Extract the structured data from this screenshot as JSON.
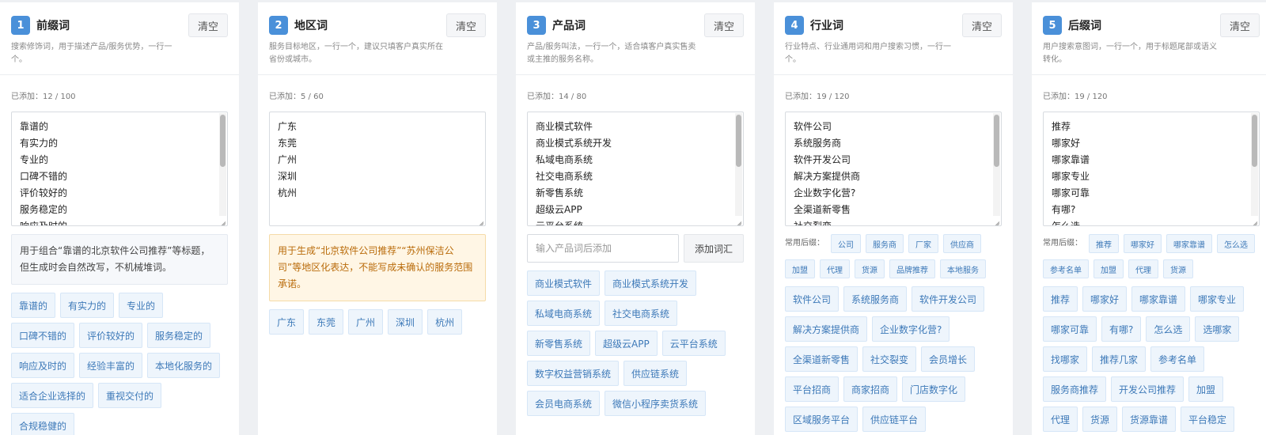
{
  "columns": [
    {
      "num": "1",
      "title": "前缀词",
      "clear": "清空",
      "desc": "搜索修饰词，用于描述产品/服务优势，一行一个。",
      "count": "已添加：12 / 100",
      "lines": [
        "靠谱的",
        "有实力的",
        "专业的",
        "口碑不错的",
        "评价较好的",
        "服务稳定的",
        "响应及时的"
      ],
      "note": "用于组合“靠谱的北京软件公司推荐”等标题，但生成时会自然改写，不机械堆词。",
      "chips": [
        "靠谱的",
        "有实力的",
        "专业的",
        "口碑不错的",
        "评价较好的",
        "服务稳定的",
        "响应及时的",
        "经验丰富的",
        "本地化服务的",
        "适合企业选择的",
        "重视交付的",
        "合规稳健的"
      ]
    },
    {
      "num": "2",
      "title": "地区词",
      "clear": "清空",
      "desc": "服务目标地区，一行一个，建议只填客户真实所在省份或城市。",
      "count": "已添加：5 / 60",
      "lines": [
        "广东",
        "东莞",
        "广州",
        "深圳",
        "杭州"
      ],
      "note": "用于生成“北京软件公司推荐”“苏州保洁公司”等地区化表达，不能写成未确认的服务范围承诺。",
      "chips": [
        "广东",
        "东莞",
        "广州",
        "深圳",
        "杭州"
      ]
    },
    {
      "num": "3",
      "title": "产品词",
      "clear": "清空",
      "desc": "产品/服务叫法，一行一个，适合填客户真实售卖或主推的服务名称。",
      "count": "已添加：14 / 80",
      "lines": [
        "商业模式软件",
        "商业模式系统开发",
        "私域电商系统",
        "社交电商系统",
        "新零售系统",
        "超级云APP",
        "云平台系统"
      ],
      "input_placeholder": "输入产品词后添加",
      "add_label": "添加词汇",
      "chips": [
        "商业模式软件",
        "商业模式系统开发",
        "私域电商系统",
        "社交电商系统",
        "新零售系统",
        "超级云APP",
        "云平台系统",
        "数字权益营销系统",
        "供应链系统",
        "会员电商系统",
        "微信小程序卖货系统"
      ]
    },
    {
      "num": "4",
      "title": "行业词",
      "clear": "清空",
      "desc": "行业特点、行业通用词和用户搜索习惯，一行一个。",
      "count": "已添加：19 / 120",
      "lines": [
        "软件公司",
        "系统服务商",
        "软件开发公司",
        "解决方案提供商",
        "企业数字化营?",
        "全渠道新零售",
        "社交裂变"
      ],
      "common_label": "常用后缀：",
      "common": [
        "公司",
        "服务商",
        "厂家",
        "供应商",
        "加盟",
        "代理",
        "货源",
        "品牌推荐",
        "本地服务"
      ],
      "chips": [
        "软件公司",
        "系统服务商",
        "软件开发公司",
        "解决方案提供商",
        "企业数字化营?",
        "全渠道新零售",
        "社交裂变",
        "会员增长",
        "平台招商",
        "商家招商",
        "门店数字化",
        "区域服务平台",
        "供应链平台"
      ]
    },
    {
      "num": "5",
      "title": "后缀词",
      "clear": "清空",
      "desc": "用户搜索意图词，一行一个，用于标题尾部或语义转化。",
      "count": "已添加：19 / 120",
      "lines": [
        "推荐",
        "哪家好",
        "哪家靠谱",
        "哪家专业",
        "哪家可靠",
        "有哪?",
        "怎么选"
      ],
      "common_label": "常用后缀：",
      "common": [
        "推荐",
        "哪家好",
        "哪家靠谱",
        "怎么选",
        "参考名单",
        "加盟",
        "代理",
        "货源"
      ],
      "chips": [
        "推荐",
        "哪家好",
        "哪家靠谱",
        "哪家专业",
        "哪家可靠",
        "有哪?",
        "怎么选",
        "选哪家",
        "找哪家",
        "推荐几家",
        "参考名单",
        "服务商推荐",
        "开发公司推荐",
        "加盟",
        "代理",
        "货源",
        "货源靠谱",
        "平台稳定"
      ]
    }
  ]
}
